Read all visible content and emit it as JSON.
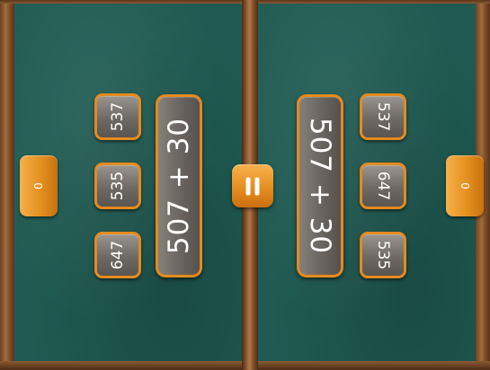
{
  "left_player": {
    "score": "0",
    "equation": "507 + 30",
    "choices": [
      "537",
      "535",
      "647"
    ]
  },
  "right_player": {
    "score": "0",
    "equation": "507 + 30",
    "choices": [
      "537",
      "647",
      "535"
    ]
  },
  "center": {
    "symbol_icon": "equals-icon"
  },
  "colors": {
    "board": "#1f5b52",
    "accent": "#e58a1e",
    "tile": "#6e6964",
    "wood": "#8a5a32"
  }
}
